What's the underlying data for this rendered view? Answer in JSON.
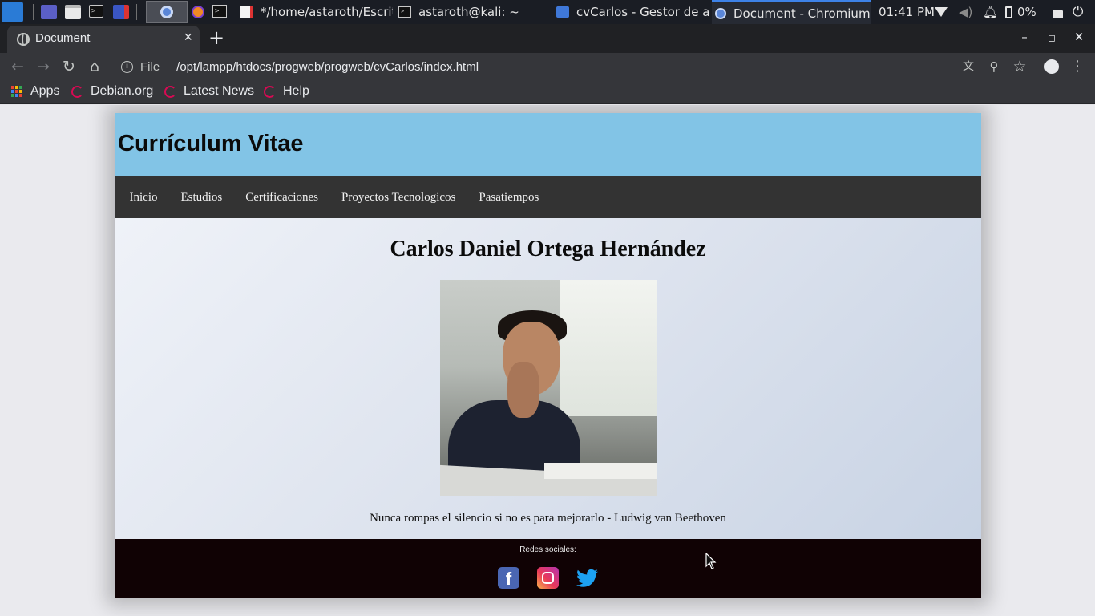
{
  "panel": {
    "tasks": [
      {
        "label": "*/home/astaroth/Escrit..."
      },
      {
        "label": "astaroth@kali: ~"
      },
      {
        "label": "cvCarlos - Gestor de arc..."
      },
      {
        "label": "Document - Chromium"
      }
    ],
    "clock": "01:41 PM",
    "battery": "0%"
  },
  "browser": {
    "tab_title": "Document",
    "url_scheme": "File",
    "url_path": "/opt/lampp/htdocs/progweb/progweb/cvCarlos/index.html",
    "bookmarks": [
      "Apps",
      "Debian.org",
      "Latest News",
      "Help"
    ]
  },
  "site": {
    "header_title": "Currículum Vitae",
    "nav": [
      "Inicio",
      "Estudios",
      "Certificaciones",
      "Proyectos Tecnologicos",
      "Pasatiempos"
    ],
    "name": "Carlos Daniel Ortega Hernández",
    "quote": "Nunca rompas el silencio si no es para mejorarlo - Ludwig van Beethoven",
    "footer_label": "Redes sociales:",
    "social": [
      {
        "name": "facebook",
        "color": "#4a66b3",
        "glyph": "f"
      },
      {
        "name": "instagram",
        "color": "#e8385a"
      },
      {
        "name": "twitter",
        "color": "#1da1f2"
      }
    ]
  },
  "colors": {
    "header_bg": "#82c4e6",
    "nav_bg": "#333333",
    "footer_bg": "#100204",
    "browser_frame": "#35363a"
  }
}
